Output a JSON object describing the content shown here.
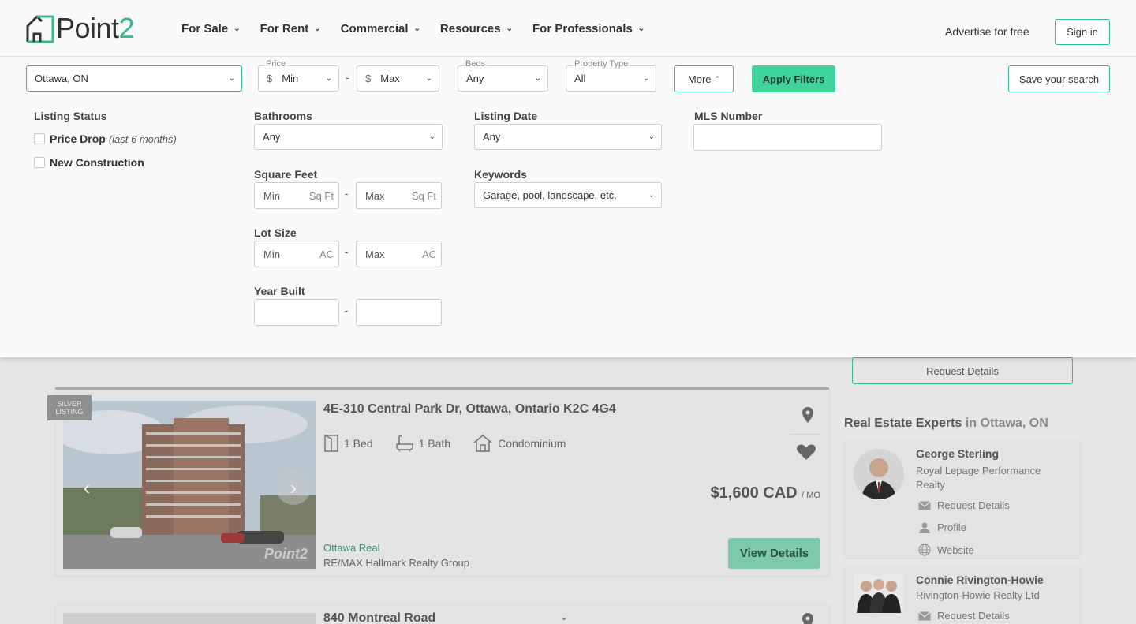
{
  "header": {
    "logo_text_main": "Point",
    "logo_text_accent": "2",
    "nav": [
      {
        "label": "For Sale"
      },
      {
        "label": "For Rent"
      },
      {
        "label": "Commercial"
      },
      {
        "label": "Resources"
      },
      {
        "label": "For Professionals"
      }
    ],
    "advertise": "Advertise for free",
    "sign_in": "Sign in"
  },
  "filters": {
    "location": "Ottawa, ON",
    "price_label": "Price",
    "price_min": "Min",
    "price_max": "Max",
    "currency_symbol": "$",
    "dash": "-",
    "beds_label": "Beds",
    "beds_value": "Any",
    "property_type_label": "Property Type",
    "property_type_value": "All",
    "more": "More",
    "apply": "Apply Filters",
    "save_search": "Save your search",
    "listing_status_label": "Listing Status",
    "price_drop": "Price Drop",
    "price_drop_note": "(last 6 months)",
    "new_construction": "New Construction",
    "bathrooms_label": "Bathrooms",
    "bathrooms_value": "Any",
    "listing_date_label": "Listing Date",
    "listing_date_value": "Any",
    "mls_label": "MLS Number",
    "mls_value": "",
    "sqft_label": "Square Feet",
    "sqft_min": "Min",
    "sqft_max": "Max",
    "sqft_unit": "Sq Ft",
    "keywords_label": "Keywords",
    "keywords_placeholder": "Garage, pool, landscape, etc.",
    "lot_label": "Lot Size",
    "lot_min": "Min",
    "lot_max": "Max",
    "lot_unit": "AC",
    "year_label": "Year Built"
  },
  "content": {
    "request_details_top": "Request Details",
    "listing": {
      "badge_line1": "SILVER",
      "badge_line2": "LISTING",
      "address": "4E-310 Central Park Dr, Ottawa, Ontario K2C 4G4",
      "beds": "1 Bed",
      "baths": "1 Bath",
      "type": "Condominium",
      "price": "$1,600 CAD",
      "price_unit": "/ MO",
      "agent_city": "Ottawa Real",
      "agent_firm": "RE/MAX Hallmark Realty Group",
      "view_details": "View Details",
      "watermark": "Point2"
    },
    "listing2": {
      "address": "840 Montreal Road"
    },
    "experts": {
      "title": "Real Estate Experts",
      "title_location": "in Ottawa, ON",
      "items": [
        {
          "name": "George Sterling",
          "firm": "Royal Lepage Performance Realty",
          "links": [
            "Request Details",
            "Profile",
            "Website"
          ]
        },
        {
          "name": "Connie Rivington-Howie",
          "firm": "Rivington-Howie Realty Ltd",
          "links": [
            "Request Details"
          ]
        }
      ]
    }
  },
  "colors": {
    "brand_green": "#2fbf88",
    "apply_button": "#3ed49a",
    "dim_background": "#e6e6e6"
  }
}
